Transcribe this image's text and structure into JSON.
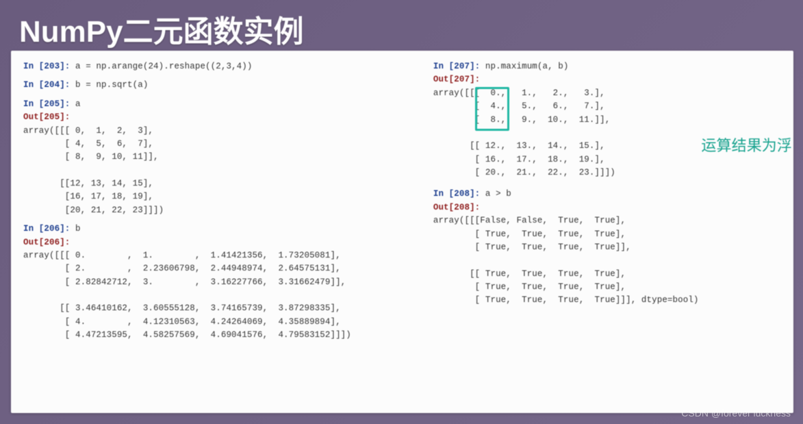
{
  "title": "NumPy二元函数实例",
  "left": {
    "c203": {
      "in": "In [203]:",
      "code": " a = np.arange(24).reshape((2,3,4))"
    },
    "c204": {
      "in": "In [204]:",
      "code": " b = np.sqrt(a)"
    },
    "c205": {
      "in": "In [205]:",
      "code": " a",
      "out": "Out[205]:",
      "arr": "array([[[ 0,  1,  2,  3],\n        [ 4,  5,  6,  7],\n        [ 8,  9, 10, 11]],\n\n       [[12, 13, 14, 15],\n        [16, 17, 18, 19],\n        [20, 21, 22, 23]]])"
    },
    "c206": {
      "in": "In [206]:",
      "code": " b",
      "out": "Out[206]:",
      "arr": "array([[[ 0.        ,  1.        ,  1.41421356,  1.73205081],\n        [ 2.        ,  2.23606798,  2.44948974,  2.64575131],\n        [ 2.82842712,  3.        ,  3.16227766,  3.31662479]],\n\n       [[ 3.46410162,  3.60555128,  3.74165739,  3.87298335],\n        [ 4.        ,  4.12310563,  4.24264069,  4.35889894],\n        [ 4.47213595,  4.58257569,  4.69041576,  4.79583152]]])"
    }
  },
  "right": {
    "c207": {
      "in": "In [207]:",
      "code": " np.maximum(a, b)",
      "out": "Out[207]:",
      "arr": "array([[[  0.,   1.,   2.,   3.],\n        [  4.,   5.,   6.,   7.],\n        [  8.,   9.,  10.,  11.]],\n\n       [[ 12.,  13.,  14.,  15.],\n        [ 16.,  17.,  18.,  19.],\n        [ 20.,  21.,  22.,  23.]]])"
    },
    "c208": {
      "in": "In [208]:",
      "code": " a > b",
      "out": "Out[208]:",
      "arr": "array([[[False, False,  True,  True],\n        [ True,  True,  True,  True],\n        [ True,  True,  True,  True]],\n\n       [[ True,  True,  True,  True],\n        [ True,  True,  True,  True],\n        [ True,  True,  True,  True]]], dtype=bool)"
    },
    "callout": "运算结果为浮"
  },
  "watermark": "CSDN @forever luckness"
}
